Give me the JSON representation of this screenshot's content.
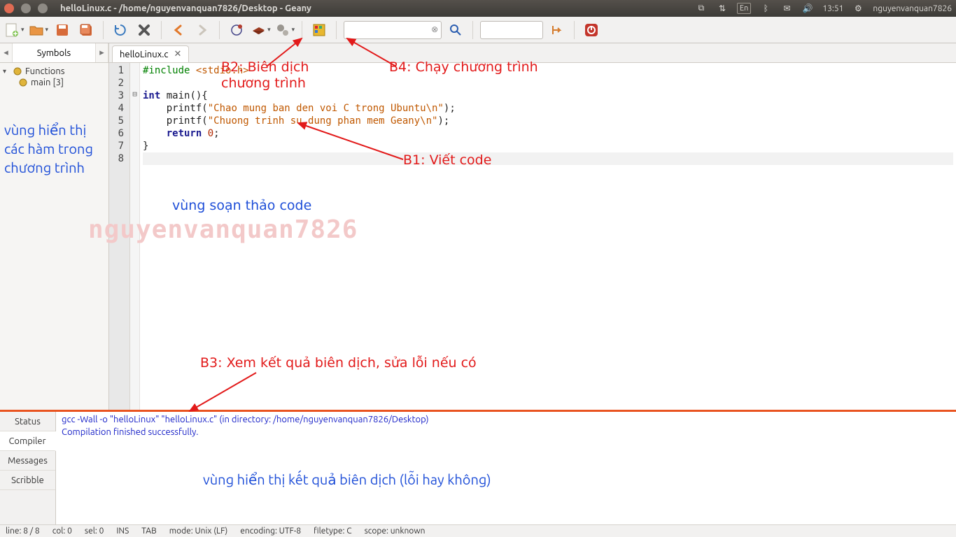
{
  "window": {
    "title": "helloLinux.c - /home/nguyenvanquan7826/Desktop - Geany"
  },
  "system_tray": {
    "lang": "En",
    "time": "13:51",
    "user": "nguyenvanquan7826"
  },
  "toolbar": {
    "search_value": "",
    "goto_value": ""
  },
  "sidebar": {
    "tab_label": "Symbols",
    "tree": {
      "root_label": "Functions",
      "items": [
        "main [3]"
      ]
    },
    "annotation": "vùng hiển thị các hàm trong chương trình"
  },
  "editor": {
    "tab_name": "helloLinux.c",
    "lines": [
      {
        "n": 1,
        "tokens": [
          [
            "pp",
            "#include "
          ],
          [
            "inc",
            "<stdio.h>"
          ]
        ]
      },
      {
        "n": 2,
        "tokens": []
      },
      {
        "n": 3,
        "fold": "-",
        "tokens": [
          [
            "kw",
            "int "
          ],
          [
            "id",
            "main"
          ],
          [
            "pun",
            "(){"
          ]
        ]
      },
      {
        "n": 4,
        "tokens": [
          [
            "pun",
            "    "
          ],
          [
            "id",
            "printf"
          ],
          [
            "pun",
            "("
          ],
          [
            "str",
            "\"Chao mung ban den voi C trong Ubuntu\\n\""
          ],
          [
            "pun",
            ");"
          ]
        ]
      },
      {
        "n": 5,
        "tokens": [
          [
            "pun",
            "    "
          ],
          [
            "id",
            "printf"
          ],
          [
            "pun",
            "("
          ],
          [
            "str",
            "\"Chuong trinh su dung phan mem Geany\\n\""
          ],
          [
            "pun",
            ");"
          ]
        ]
      },
      {
        "n": 6,
        "tokens": [
          [
            "pun",
            "    "
          ],
          [
            "kw",
            "return "
          ],
          [
            "num",
            "0"
          ],
          [
            "pun",
            ";"
          ]
        ]
      },
      {
        "n": 7,
        "tokens": [
          [
            "pun",
            "}"
          ]
        ]
      },
      {
        "n": 8,
        "caret": true,
        "tokens": []
      }
    ]
  },
  "annotations": {
    "b1": "B1: Viết code",
    "b2_1": "B2: Biên dịch",
    "b2_2": "chương trình",
    "b3": "B3: Xem kết quả biên dịch, sửa lỗi nếu có",
    "b4": "B4: Chạy chương trình",
    "code_area": "vùng soạn thảo code",
    "compiler_area": "vùng hiển thị kết quả biên dịch (lỗi hay không)",
    "watermark": "nguyenvanquan7826"
  },
  "compiler": {
    "tabs": [
      "Status",
      "Compiler",
      "Messages",
      "Scribble"
    ],
    "active_tab": 1,
    "lines": [
      "gcc -Wall -o \"helloLinux\" \"helloLinux.c\" (in directory: /home/nguyenvanquan7826/Desktop)",
      "Compilation finished successfully."
    ]
  },
  "statusbar": {
    "segments": [
      "line: 8 / 8",
      "col: 0",
      "sel: 0",
      "INS",
      "TAB",
      "mode: Unix (LF)",
      "encoding: UTF-8",
      "filetype: C",
      "scope: unknown"
    ]
  }
}
